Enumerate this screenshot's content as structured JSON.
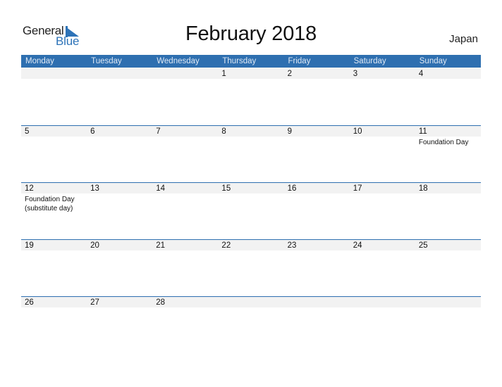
{
  "logo": {
    "word1": "General",
    "word2": "Blue"
  },
  "title": "February 2018",
  "country": "Japan",
  "colors": {
    "header_bg": "#2e6fb0",
    "day_bar": "#f2f2f2",
    "brand_blue": "#2d73b8"
  },
  "weekdays": [
    "Monday",
    "Tuesday",
    "Wednesday",
    "Thursday",
    "Friday",
    "Saturday",
    "Sunday"
  ],
  "weeks": [
    {
      "days": [
        {
          "n": ""
        },
        {
          "n": ""
        },
        {
          "n": ""
        },
        {
          "n": "1"
        },
        {
          "n": "2"
        },
        {
          "n": "3"
        },
        {
          "n": "4"
        }
      ]
    },
    {
      "days": [
        {
          "n": "5"
        },
        {
          "n": "6"
        },
        {
          "n": "7"
        },
        {
          "n": "8"
        },
        {
          "n": "9"
        },
        {
          "n": "10"
        },
        {
          "n": "11",
          "holiday": "Foundation Day"
        }
      ]
    },
    {
      "days": [
        {
          "n": "12",
          "holiday": "Foundation Day (substitute day)"
        },
        {
          "n": "13"
        },
        {
          "n": "14"
        },
        {
          "n": "15"
        },
        {
          "n": "16"
        },
        {
          "n": "17"
        },
        {
          "n": "18"
        }
      ]
    },
    {
      "days": [
        {
          "n": "19"
        },
        {
          "n": "20"
        },
        {
          "n": "21"
        },
        {
          "n": "22"
        },
        {
          "n": "23"
        },
        {
          "n": "24"
        },
        {
          "n": "25"
        }
      ]
    },
    {
      "days": [
        {
          "n": "26"
        },
        {
          "n": "27"
        },
        {
          "n": "28"
        },
        {
          "n": ""
        },
        {
          "n": ""
        },
        {
          "n": ""
        },
        {
          "n": ""
        }
      ]
    }
  ]
}
